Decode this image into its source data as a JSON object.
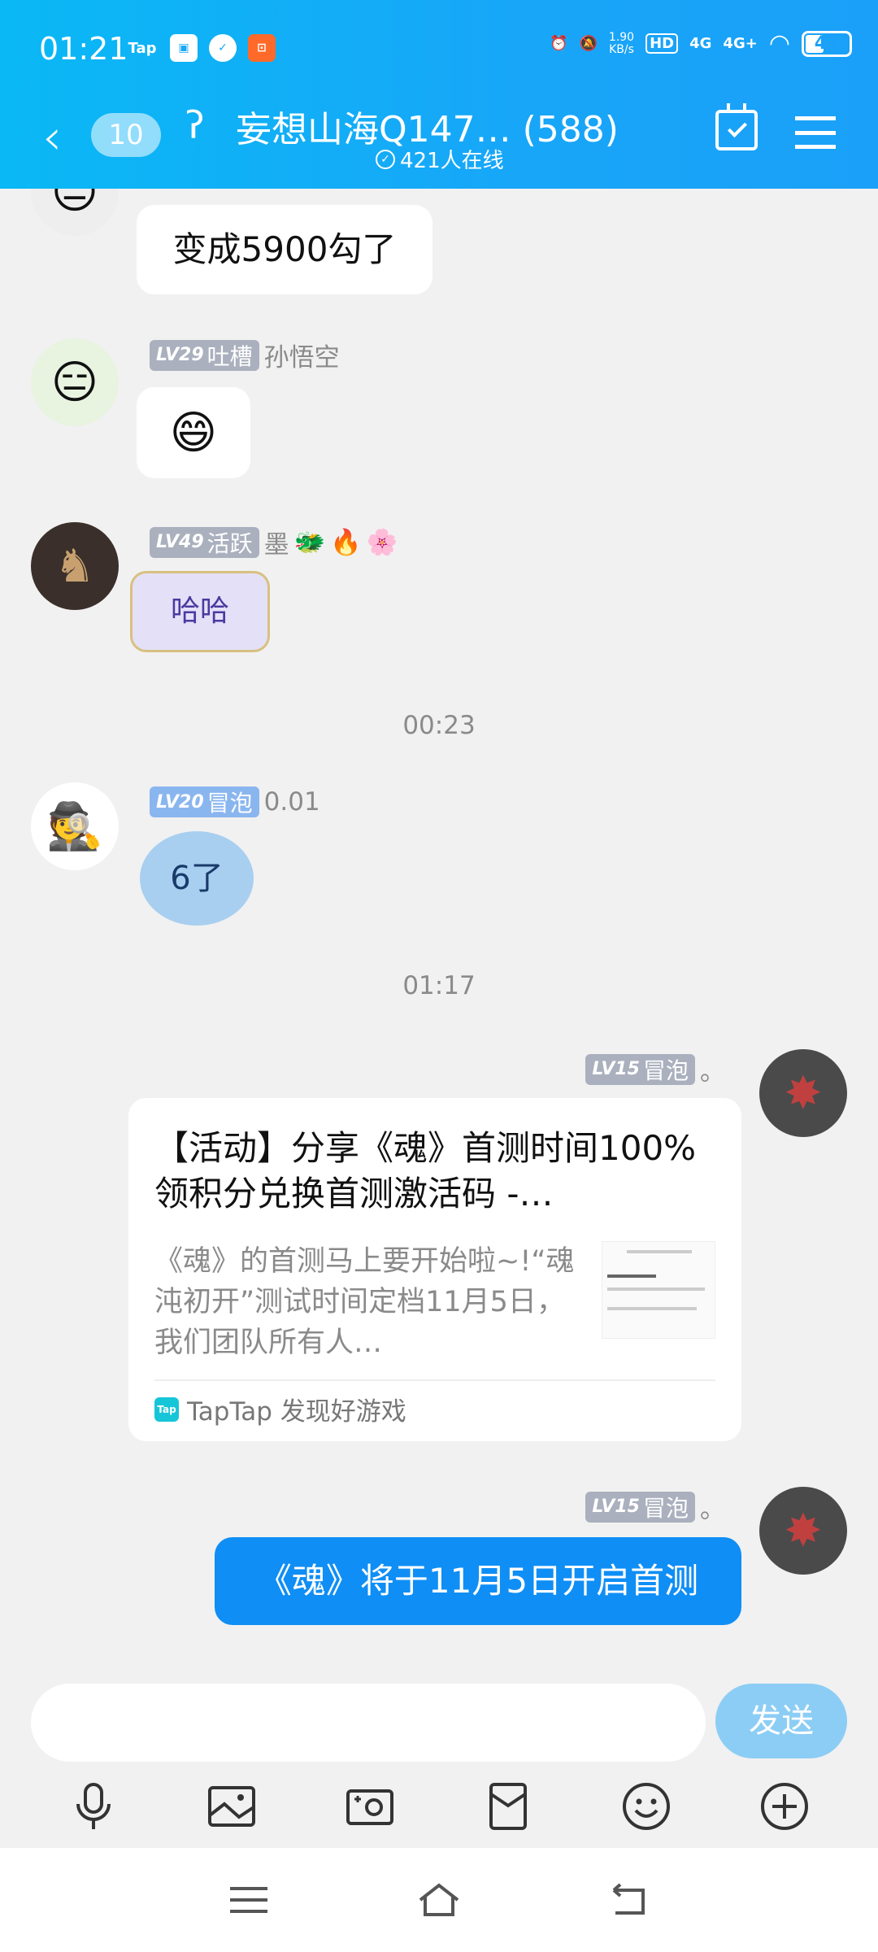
{
  "status_bar": {
    "time": "01:21",
    "tap_label": "Tap",
    "net_speed_top": "1.90",
    "net_speed_bottom": "KB/s",
    "hd_label": "HD",
    "net1": "4G",
    "net2": "4G+",
    "battery": "41"
  },
  "header": {
    "back_count": "10",
    "title": "妄想山海Q147…  (588)",
    "online": "421人在线"
  },
  "messages": [
    {
      "text": "变成5900勾了"
    },
    {
      "level": "LV29",
      "tag": "吐槽",
      "name": "孙悟空",
      "sticker": "😄"
    },
    {
      "level": "LV49",
      "tag": "活跃",
      "name": "墨",
      "sticker_text": "哈哈"
    },
    {
      "timestamp": "00:23"
    },
    {
      "level": "LV20",
      "tag": "冒泡",
      "name": "0.01",
      "sticker_text": "6了"
    },
    {
      "timestamp": "01:17"
    },
    {
      "level": "LV15",
      "tag": "冒泡",
      "name": "。",
      "card": {
        "title": "【活动】分享《魂》首测时间100%领积分兑换首测激活码 -…",
        "desc": "《魂》的首测马上要开始啦~!“魂沌初开”测试时间定档11月5日，我们团队所有人…",
        "source": "TapTap 发现好游戏",
        "logo": "Tap"
      }
    },
    {
      "level": "LV15",
      "tag": "冒泡",
      "name": "。",
      "text": "《魂》将于11月5日开启首测"
    }
  ],
  "input": {
    "placeholder": "",
    "send_label": "发送"
  },
  "toolbar_icons": [
    "microphone-icon",
    "image-icon",
    "camera-icon",
    "red-packet-icon",
    "emoji-icon",
    "plus-icon"
  ]
}
